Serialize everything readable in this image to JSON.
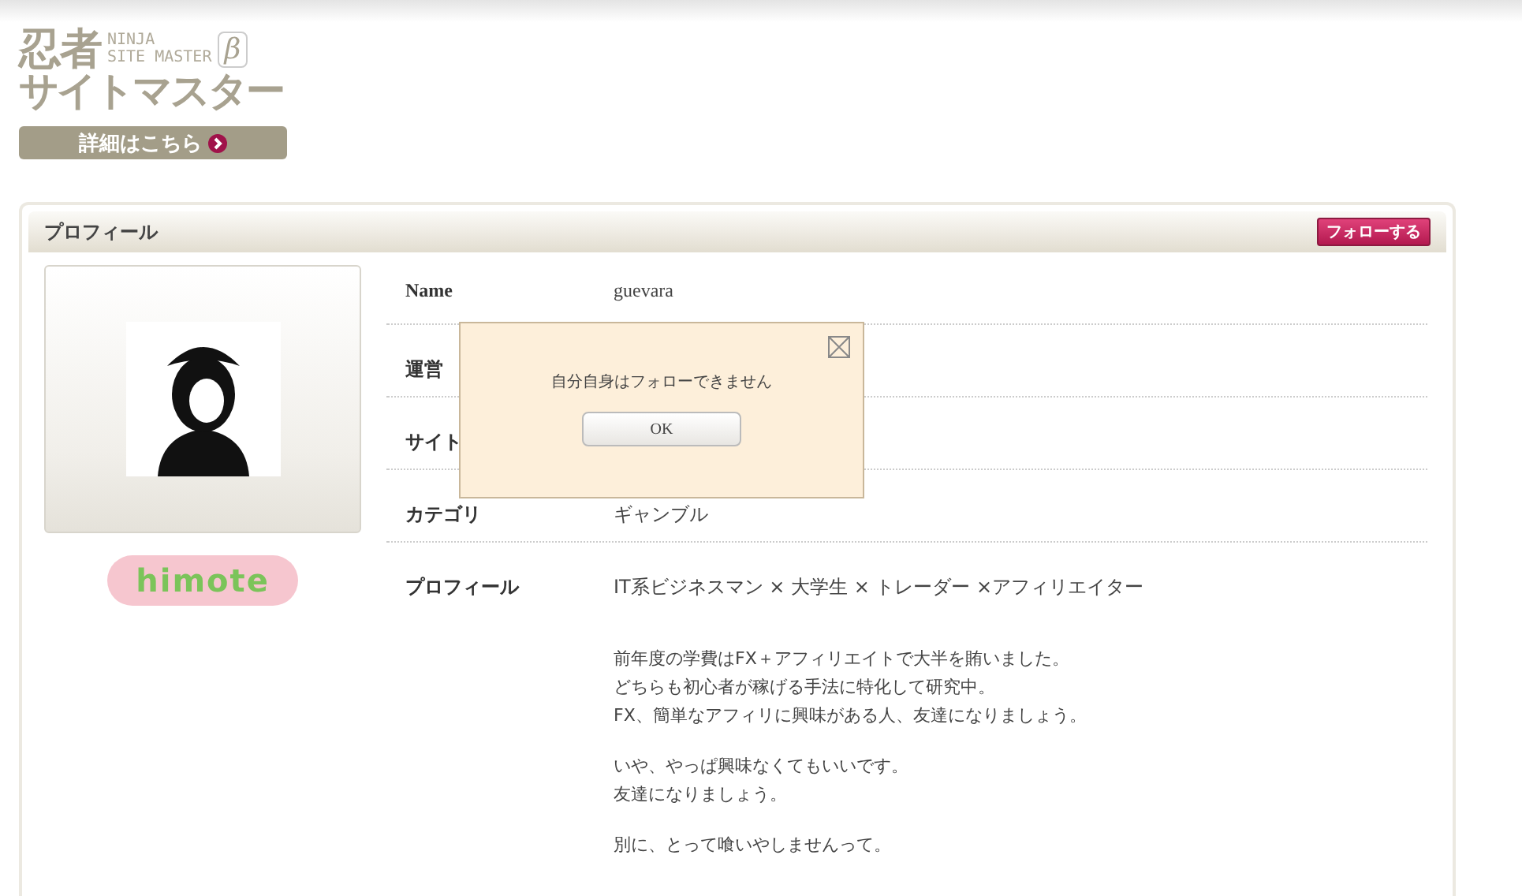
{
  "logo": {
    "title_top": "忍者",
    "subtitle_top": "NINJA",
    "subtitle_bottom": "SITE MASTER",
    "beta": "β",
    "title_bottom": "サイトマスター",
    "details_button": "詳細はこちら"
  },
  "panel": {
    "title": "プロフィール",
    "follow_button": "フォローする"
  },
  "avatar": {
    "kind": "picture"
  },
  "badge": {
    "text": "himote"
  },
  "rows": [
    {
      "label": "Name",
      "value": "guevara"
    },
    {
      "label": "運営",
      "value": null
    },
    {
      "label": "サイト",
      "value": null
    },
    {
      "label": "カテゴリ",
      "value": "ギャンブル"
    },
    {
      "label": "プロフィール",
      "value": "IT系ビジネスマン × 大学生 × トレーダー ×アフィリエイター"
    }
  ],
  "profile_paragraphs": [
    [
      "前年度の学費はFX＋アフィリエイトで大半を賄いました。",
      "どちらも初心者が稼げる手法に特化して研究中。",
      "FX、簡単なアフィリに興味がある人、友達になりましょう。"
    ],
    [
      "いや、やっぱ興味なくてもいいです。",
      "友達になりましょう。"
    ],
    [
      "別に、とって喰いやしませんって。"
    ]
  ],
  "dialog": {
    "message": "自分自身はフォローできません",
    "ok_button": "OK"
  }
}
